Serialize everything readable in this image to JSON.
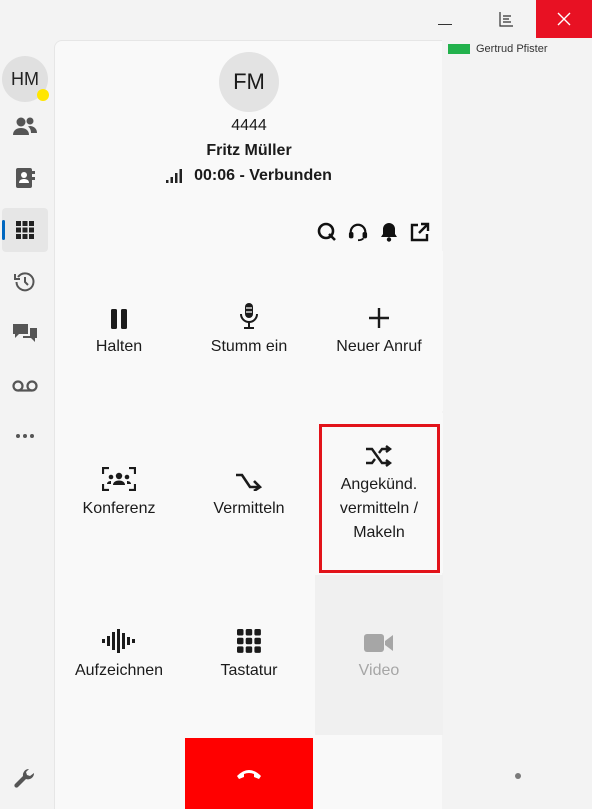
{
  "window": {
    "controls": [
      "minimize",
      "maximize",
      "close"
    ]
  },
  "user": {
    "initials": "HM",
    "presence_color": "#ffe600"
  },
  "nav": {
    "items": [
      {
        "name": "contacts-icon"
      },
      {
        "name": "address-book-icon"
      },
      {
        "name": "dialpad-icon",
        "active": true
      },
      {
        "name": "history-icon"
      },
      {
        "name": "chat-icon"
      },
      {
        "name": "voicemail-icon"
      },
      {
        "name": "more-icon"
      }
    ],
    "settings_icon": "wrench-icon"
  },
  "call": {
    "initials": "FM",
    "number": "4444",
    "name": "Fritz Müller",
    "status": "00:06 - Verbunden"
  },
  "toolbar": [
    "queue-icon",
    "headset-icon",
    "bell-icon",
    "popout-icon"
  ],
  "actions": [
    {
      "label": "Halten",
      "icon": "pause-icon"
    },
    {
      "label": "Stumm ein",
      "icon": "microphone-icon"
    },
    {
      "label": "Neuer Anruf",
      "icon": "plus-icon"
    },
    {
      "label": "Konferenz",
      "icon": "conference-icon"
    },
    {
      "label": "Vermitteln",
      "icon": "transfer-icon"
    },
    {
      "label": "Angekünd. vermitteln / Makeln",
      "icon": "shuffle-icon"
    },
    {
      "label": "Aufzeichnen",
      "icon": "record-waveform-icon"
    },
    {
      "label": "Tastatur",
      "icon": "keypad-icon"
    },
    {
      "label": "Video",
      "icon": "video-icon",
      "disabled": true
    }
  ],
  "agent": {
    "name": "Gertrud Pfister",
    "status_color": "#22b14c"
  },
  "colors": {
    "hangup": "#ff0000",
    "close": "#e81123",
    "accent": "#0067c0",
    "highlight": "#e2131a"
  }
}
